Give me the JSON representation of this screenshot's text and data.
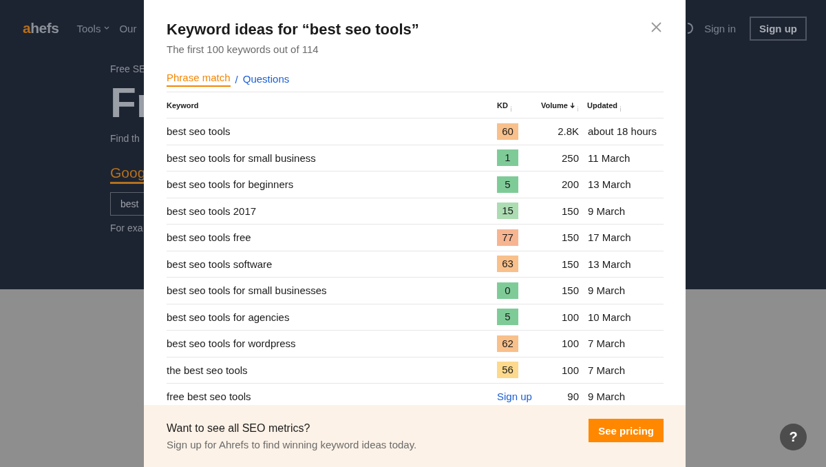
{
  "background": {
    "logo": {
      "accent": "a",
      "rest": "hefs"
    },
    "nav": [
      {
        "label": "Tools",
        "dropdown": true
      },
      {
        "label": "Our",
        "dropdown": false
      }
    ],
    "sign_in": "Sign in",
    "sign_up": "Sign up",
    "hero": {
      "eyebrow": "Free SE",
      "title": "Fr",
      "subtitle": "Find th",
      "tab": "Goog",
      "input_value": "best",
      "hint": "For exa"
    }
  },
  "modal": {
    "title": "Keyword ideas for “best seo tools”",
    "subtitle": "The first 100 keywords out of 114",
    "tabs": [
      {
        "label": "Phrase match",
        "selected": true
      },
      {
        "label": "Questions",
        "selected": false
      }
    ],
    "tab_separator": "/",
    "table": {
      "columns": [
        {
          "label": "Keyword",
          "info": false,
          "sorted": false
        },
        {
          "label": "KD",
          "info": true,
          "sorted": false
        },
        {
          "label": "Volume",
          "info": true,
          "sorted": true
        },
        {
          "label": "Updated",
          "info": true,
          "sorted": false
        }
      ],
      "rows": [
        {
          "keyword": "best seo tools",
          "kind": "badge",
          "kd": "60",
          "color": "#f8c08b",
          "volume": "2.8K",
          "updated": "about 18 hours"
        },
        {
          "keyword": "best seo tools for small business",
          "kind": "badge",
          "kd": "1",
          "color": "#7fcb98",
          "volume": "250",
          "updated": "11 March"
        },
        {
          "keyword": "best seo tools for beginners",
          "kind": "badge",
          "kd": "5",
          "color": "#7fcb98",
          "volume": "200",
          "updated": "13 March"
        },
        {
          "keyword": "best seo tools 2017",
          "kind": "badge",
          "kd": "15",
          "color": "#acdcb2",
          "volume": "150",
          "updated": "9 March"
        },
        {
          "keyword": "best seo tools free",
          "kind": "badge",
          "kd": "77",
          "color": "#f7b491",
          "volume": "150",
          "updated": "17 March"
        },
        {
          "keyword": "best seo tools software",
          "kind": "badge",
          "kd": "63",
          "color": "#f8c08b",
          "volume": "150",
          "updated": "13 March"
        },
        {
          "keyword": "best seo tools for small businesses",
          "kind": "badge",
          "kd": "0",
          "color": "#7fcb98",
          "volume": "150",
          "updated": "9 March"
        },
        {
          "keyword": "best seo tools for agencies",
          "kind": "badge",
          "kd": "5",
          "color": "#7fcb98",
          "volume": "100",
          "updated": "10 March"
        },
        {
          "keyword": "best seo tools for wordpress",
          "kind": "badge",
          "kd": "62",
          "color": "#f8c08b",
          "volume": "100",
          "updated": "7 March"
        },
        {
          "keyword": "the best seo tools",
          "kind": "badge",
          "kd": "56",
          "color": "#fcd98c",
          "volume": "100",
          "updated": "7 March"
        },
        {
          "keyword": "free best seo tools",
          "kind": "link",
          "kd": "Sign up",
          "volume": "90",
          "updated": "9 March"
        }
      ]
    },
    "footer": {
      "title": "Want to see all SEO metrics?",
      "text": "Sign up for Ahrefs to find winning keyword ideas today.",
      "button": "See pricing"
    }
  },
  "help_button": "?"
}
